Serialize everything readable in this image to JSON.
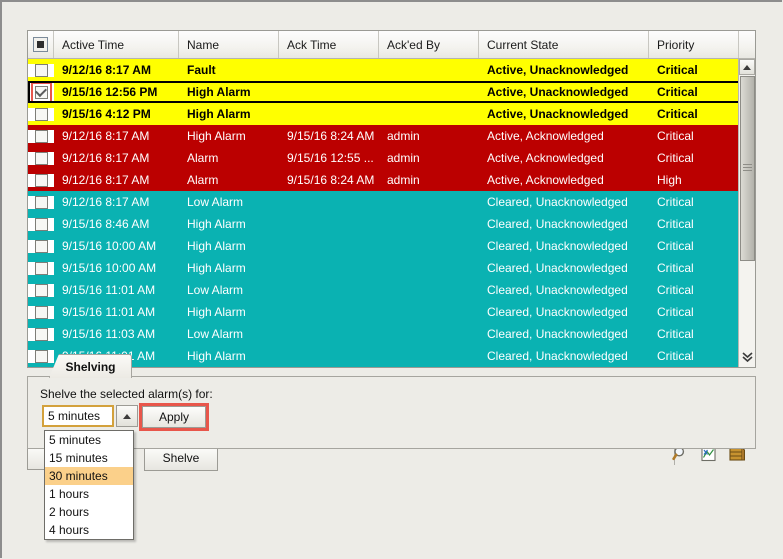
{
  "table": {
    "columns": [
      "Active Time",
      "Name",
      "Ack Time",
      "Ack'ed By",
      "Current State",
      "Priority"
    ],
    "rows": [
      {
        "active_time": "9/12/16 8:17 AM",
        "name": "Fault",
        "ack_time": "",
        "acked_by": "",
        "state": "Active, Unacknowledged",
        "priority": "Critical",
        "style": "yellow",
        "checked": false,
        "selected": false
      },
      {
        "active_time": "9/15/16 12:56 PM",
        "name": "High Alarm",
        "ack_time": "",
        "acked_by": "",
        "state": "Active, Unacknowledged",
        "priority": "Critical",
        "style": "yellow",
        "checked": true,
        "selected": true
      },
      {
        "active_time": "9/15/16 4:12 PM",
        "name": "High Alarm",
        "ack_time": "",
        "acked_by": "",
        "state": "Active, Unacknowledged",
        "priority": "Critical",
        "style": "yellow",
        "checked": false,
        "selected": false
      },
      {
        "active_time": "9/12/16 8:17 AM",
        "name": "High Alarm",
        "ack_time": "9/15/16 8:24 AM",
        "acked_by": "admin",
        "state": "Active, Acknowledged",
        "priority": "Critical",
        "style": "red",
        "checked": false,
        "selected": false
      },
      {
        "active_time": "9/12/16 8:17 AM",
        "name": "Alarm",
        "ack_time": "9/15/16 12:55 ...",
        "acked_by": "admin",
        "state": "Active, Acknowledged",
        "priority": "Critical",
        "style": "red",
        "checked": false,
        "selected": false
      },
      {
        "active_time": "9/12/16 8:17 AM",
        "name": "Alarm",
        "ack_time": "9/15/16 8:24 AM",
        "acked_by": "admin",
        "state": "Active, Acknowledged",
        "priority": "High",
        "style": "red",
        "checked": false,
        "selected": false
      },
      {
        "active_time": "9/12/16 8:17 AM",
        "name": "Low Alarm",
        "ack_time": "",
        "acked_by": "",
        "state": "Cleared, Unacknowledged",
        "priority": "Critical",
        "style": "teal",
        "checked": false,
        "selected": false
      },
      {
        "active_time": "9/15/16 8:46 AM",
        "name": "High Alarm",
        "ack_time": "",
        "acked_by": "",
        "state": "Cleared, Unacknowledged",
        "priority": "Critical",
        "style": "teal",
        "checked": false,
        "selected": false
      },
      {
        "active_time": "9/15/16 10:00 AM",
        "name": "High Alarm",
        "ack_time": "",
        "acked_by": "",
        "state": "Cleared, Unacknowledged",
        "priority": "Critical",
        "style": "teal",
        "checked": false,
        "selected": false
      },
      {
        "active_time": "9/15/16 10:00 AM",
        "name": "High Alarm",
        "ack_time": "",
        "acked_by": "",
        "state": "Cleared, Unacknowledged",
        "priority": "Critical",
        "style": "teal",
        "checked": false,
        "selected": false
      },
      {
        "active_time": "9/15/16 11:01 AM",
        "name": "Low Alarm",
        "ack_time": "",
        "acked_by": "",
        "state": "Cleared, Unacknowledged",
        "priority": "Critical",
        "style": "teal",
        "checked": false,
        "selected": false
      },
      {
        "active_time": "9/15/16 11:01 AM",
        "name": "High Alarm",
        "ack_time": "",
        "acked_by": "",
        "state": "Cleared, Unacknowledged",
        "priority": "Critical",
        "style": "teal",
        "checked": false,
        "selected": false
      },
      {
        "active_time": "9/15/16 11:03 AM",
        "name": "Low Alarm",
        "ack_time": "",
        "acked_by": "",
        "state": "Cleared, Unacknowledged",
        "priority": "Critical",
        "style": "teal",
        "checked": false,
        "selected": false
      },
      {
        "active_time": "9/15/16 11:01 AM",
        "name": "High Alarm",
        "ack_time": "",
        "acked_by": "",
        "state": "Cleared, Unacknowledged",
        "priority": "Critical",
        "style": "teal",
        "checked": false,
        "selected": false
      }
    ]
  },
  "shelving": {
    "tab_label": "Shelving",
    "prompt": "Shelve the selected alarm(s) for:",
    "duration_value": "5 minutes",
    "apply_label": "Apply",
    "shelve_label": "Shelve",
    "options": [
      "5 minutes",
      "15 minutes",
      "30 minutes",
      "1 hours",
      "2 hours",
      "4 hours"
    ],
    "highlighted_option": "30 minutes"
  },
  "icons": {
    "search": "magnifier-icon",
    "export": "spreadsheet-export-icon",
    "archive": "archive-drawer-icon"
  },
  "colors": {
    "unacknowledged": "#ffff00",
    "acknowledged": "#bb0000",
    "cleared": "#0ab2b2",
    "highlight": "#e8564b",
    "focus": "#d3a13c",
    "menu_highlight": "#fbd08a"
  }
}
